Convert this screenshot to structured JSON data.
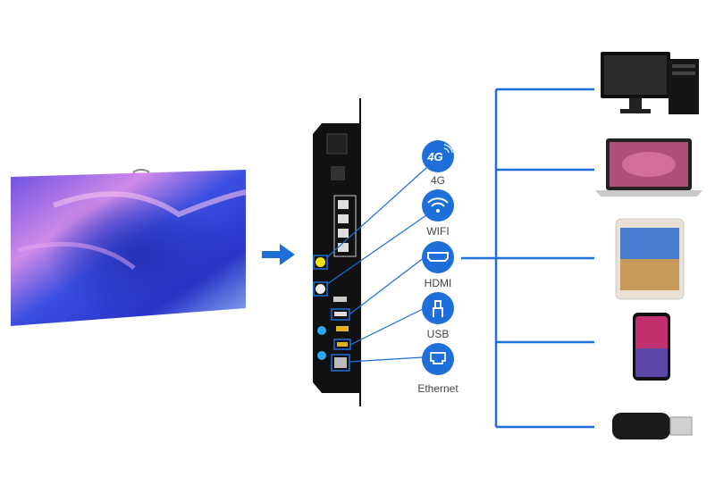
{
  "colors": {
    "accent": "#1e6fd9",
    "device": "#111111"
  },
  "interfaces": [
    {
      "label": "4G",
      "icon": "4g-icon",
      "badge": "4G"
    },
    {
      "label": "WIFI",
      "icon": "wifi-icon"
    },
    {
      "label": "HDMI",
      "icon": "hdmi-icon"
    },
    {
      "label": "USB",
      "icon": "usb-icon"
    },
    {
      "label": "Ethernet",
      "icon": "ethernet-icon"
    }
  ],
  "devices": [
    "desktop-pc",
    "laptop",
    "tablet",
    "smartphone",
    "usb-flash-drive"
  ]
}
